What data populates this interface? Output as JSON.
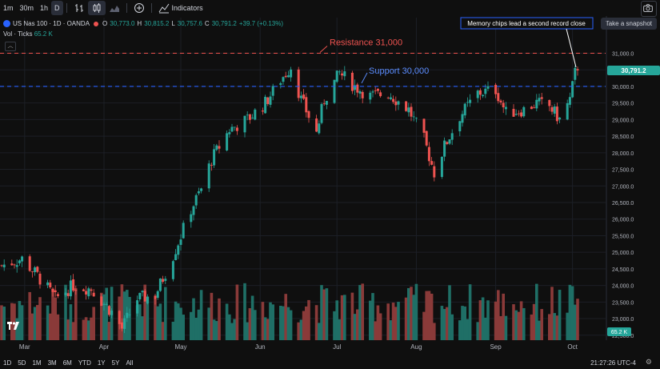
{
  "toolbar": {
    "intervals": [
      "1m",
      "30m",
      "1h",
      "D"
    ],
    "selected_interval": "D",
    "indicators_label": "Indicators",
    "snapshot_tooltip": "Take a snapshot"
  },
  "legend": {
    "symbol": "US Nas 100 · 1D · OANDA",
    "open_label": "O",
    "open": "30,773.0",
    "high_label": "H",
    "high": "30,815.2",
    "low_label": "L",
    "low": "30,757.6",
    "close_label": "C",
    "close": "30,791.2",
    "change": "+39.7 (+0.13%)",
    "volume_label": "Vol · Ticks",
    "volume_value": "65.2 K"
  },
  "annotations": {
    "resistance": "Resistance 31,000",
    "support": "Support 30,000",
    "callout": "Memory chips lead a second record close"
  },
  "bottom": {
    "ranges": [
      "1D",
      "5D",
      "1M",
      "3M",
      "6M",
      "YTD",
      "1Y",
      "5Y",
      "All"
    ],
    "clock": "21:27:26 UTC-4"
  },
  "colors": {
    "up": "#26a69a",
    "down": "#ef5350",
    "resistance": "#ef5350",
    "support": "#2962ff",
    "bg": "#0f0f0f"
  },
  "chart_data": {
    "type": "candlestick",
    "title": "US Nas 100 · 1D · OANDA",
    "x_start_date": "2025-02-20",
    "month_labels": [
      {
        "label": "Mar",
        "date": "2025-03-01"
      },
      {
        "label": "Apr",
        "date": "2025-04-01"
      },
      {
        "label": "May",
        "date": "2025-05-01"
      },
      {
        "label": "Jun",
        "date": "2025-06-01"
      },
      {
        "label": "Jul",
        "date": "2025-07-01"
      },
      {
        "label": "Aug",
        "date": "2025-08-01"
      },
      {
        "label": "Sep",
        "date": "2025-09-01"
      },
      {
        "label": "Oct",
        "date": "2025-10-01"
      }
    ],
    "y_ticks": [
      "31,000.0",
      "30,500.0",
      "30,000.0",
      "29,500.0",
      "29,000.0",
      "28,500.0",
      "28,000.0",
      "27,500.0",
      "27,000.0",
      "26,500.0",
      "26,000.0",
      "25,500.0",
      "25,000.0",
      "24,500.0",
      "24,000.0",
      "23,500.0",
      "23,000.0",
      "22,500.0"
    ],
    "ylim": [
      22350,
      31350
    ],
    "last_price": "30,791.2",
    "last_volume": "65.2 K",
    "resistance_level": 31000,
    "support_level": 30000,
    "close_path": [
      [
        "2025-02-20",
        24600
      ],
      [
        "2025-02-28",
        24800
      ],
      [
        "2025-03-06",
        24300
      ],
      [
        "2025-03-13",
        23600
      ],
      [
        "2025-03-20",
        24000
      ],
      [
        "2025-03-27",
        23900
      ],
      [
        "2025-04-04",
        23200
      ],
      [
        "2025-04-08",
        22700
      ],
      [
        "2025-04-14",
        23600
      ],
      [
        "2025-04-21",
        23700
      ],
      [
        "2025-04-28",
        24900
      ],
      [
        "2025-05-05",
        26300
      ],
      [
        "2025-05-09",
        26900
      ],
      [
        "2025-05-13",
        27800
      ],
      [
        "2025-05-20",
        28700
      ],
      [
        "2025-05-27",
        29000
      ],
      [
        "2025-06-03",
        29500
      ],
      [
        "2025-06-09",
        30200
      ],
      [
        "2025-06-13",
        30600
      ],
      [
        "2025-06-17",
        29600
      ],
      [
        "2025-06-23",
        28600
      ],
      [
        "2025-06-26",
        29600
      ],
      [
        "2025-07-02",
        30400
      ],
      [
        "2025-07-08",
        30000
      ],
      [
        "2025-07-14",
        29700
      ],
      [
        "2025-07-21",
        29800
      ],
      [
        "2025-07-29",
        29300
      ],
      [
        "2025-08-04",
        28400
      ],
      [
        "2025-08-08",
        27400
      ],
      [
        "2025-08-12",
        28200
      ],
      [
        "2025-08-18",
        29100
      ],
      [
        "2025-08-25",
        29800
      ],
      [
        "2025-09-01",
        29900
      ],
      [
        "2025-09-05",
        29200
      ],
      [
        "2025-09-12",
        29300
      ],
      [
        "2025-09-17",
        29500
      ],
      [
        "2025-09-22",
        29400
      ],
      [
        "2025-09-26",
        29000
      ],
      [
        "2025-09-30",
        29600
      ],
      [
        "2025-10-02",
        30400
      ],
      [
        "2025-10-04",
        30791
      ]
    ],
    "volume_ylim": [
      0,
      140000
    ]
  }
}
